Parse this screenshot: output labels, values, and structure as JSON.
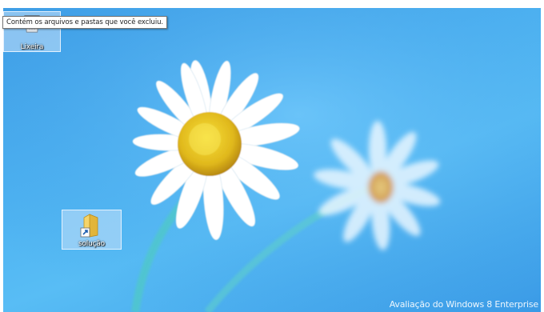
{
  "desktop": {
    "icons": [
      {
        "label": "Lixeira",
        "icon": "recycle-bin-icon"
      },
      {
        "label": "solução",
        "icon": "folder-shortcut-icon"
      }
    ],
    "tooltip": "Contém os arquivos e pastas que você excluiu.",
    "watermark": "Avaliação do Windows 8 Enterprise"
  },
  "colors": {
    "wallpaper_blue": "#4cb0f0",
    "selection": "#c8e1fa",
    "folder_yellow": "#f2c94c"
  }
}
